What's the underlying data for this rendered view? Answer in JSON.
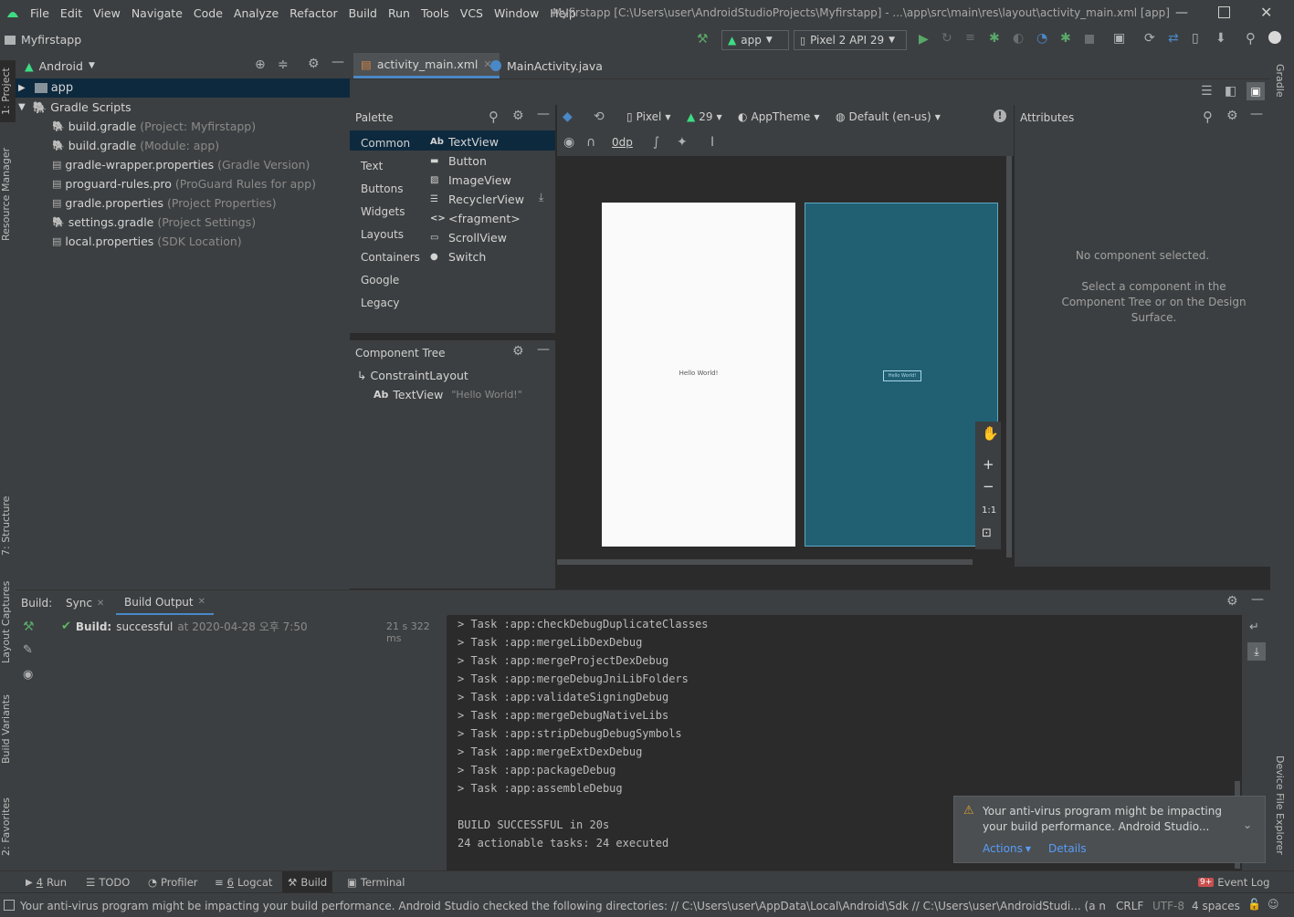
{
  "menu": [
    "File",
    "Edit",
    "View",
    "Navigate",
    "Code",
    "Analyze",
    "Refactor",
    "Build",
    "Run",
    "Tools",
    "VCS",
    "Window",
    "Help"
  ],
  "window_title": "Myfirstapp [C:\\Users\\user\\AndroidStudioProjects\\Myfirstapp] - ...\\app\\src\\main\\res\\layout\\activity_main.xml [app]",
  "toolbar": {
    "project": "Myfirstapp",
    "run_config": "app",
    "device": "Pixel 2 API 29"
  },
  "left_tabs": [
    "1: Project",
    "Resource Manager",
    "7: Structure",
    "Layout Captures",
    "Build Variants",
    "2: Favorites"
  ],
  "right_tabs": [
    "Gradle",
    "Device File Explorer"
  ],
  "project": {
    "view": "Android",
    "items": [
      {
        "label": "app",
        "hint": ""
      },
      {
        "label": "Gradle Scripts",
        "hint": ""
      },
      {
        "label": "build.gradle",
        "hint": "(Project: Myfirstapp)"
      },
      {
        "label": "build.gradle",
        "hint": "(Module: app)"
      },
      {
        "label": "gradle-wrapper.properties",
        "hint": "(Gradle Version)"
      },
      {
        "label": "proguard-rules.pro",
        "hint": "(ProGuard Rules for app)"
      },
      {
        "label": "gradle.properties",
        "hint": "(Project Properties)"
      },
      {
        "label": "settings.gradle",
        "hint": "(Project Settings)"
      },
      {
        "label": "local.properties",
        "hint": "(SDK Location)"
      }
    ]
  },
  "editor_tabs": [
    "activity_main.xml",
    "MainActivity.java"
  ],
  "palette": {
    "title": "Palette",
    "categories": [
      "Common",
      "Text",
      "Buttons",
      "Widgets",
      "Layouts",
      "Containers",
      "Google",
      "Legacy"
    ],
    "items": [
      "TextView",
      "Button",
      "ImageView",
      "RecyclerView",
      "<fragment>",
      "ScrollView",
      "Switch"
    ]
  },
  "design_toolbar": {
    "device": "Pixel",
    "api": "29",
    "theme": "AppTheme",
    "locale": "Default (en-us)",
    "margin": "0dp"
  },
  "component_tree": {
    "title": "Component Tree",
    "root": "ConstraintLayout",
    "child": "TextView",
    "child_text": "\"Hello World!\""
  },
  "preview_text": "Hello World!",
  "zoom_controls": [
    "+",
    "−",
    "1:1"
  ],
  "attributes": {
    "title": "Attributes",
    "empty": "No component selected.",
    "hint": "Select a component in the Component Tree or on the Design Surface."
  },
  "build": {
    "label": "Build:",
    "tabs": [
      "Sync",
      "Build Output"
    ],
    "result_label": "Build:",
    "result_status": "successful",
    "result_time": "at 2020-04-28 오후 7:50",
    "duration": "21 s 322 ms",
    "console": [
      "> Task :app:checkDebugDuplicateClasses",
      "> Task :app:mergeLibDexDebug",
      "> Task :app:mergeProjectDexDebug",
      "> Task :app:mergeDebugJniLibFolders",
      "> Task :app:validateSigningDebug",
      "> Task :app:mergeDebugNativeLibs",
      "> Task :app:stripDebugDebugSymbols",
      "> Task :app:mergeExtDexDebug",
      "> Task :app:packageDebug",
      "> Task :app:assembleDebug",
      "",
      "BUILD SUCCESSFUL in 20s",
      "24 actionable tasks: 24 executed"
    ]
  },
  "notification": {
    "text": "Your anti-virus program might be impacting your build performance. Android Studio...",
    "actions": "Actions",
    "details": "Details"
  },
  "bottom_tabs": [
    {
      "num": "4",
      "label": "Run"
    },
    {
      "num": "",
      "label": "TODO"
    },
    {
      "num": "",
      "label": "Profiler"
    },
    {
      "num": "6",
      "label": "Logcat"
    },
    {
      "num": "",
      "label": "Build"
    },
    {
      "num": "",
      "label": "Terminal"
    }
  ],
  "event_log": {
    "badge": "9+",
    "label": "Event Log"
  },
  "status": {
    "message": "Your anti-virus program might be impacting your build performance. Android Studio checked the following directories: // C:\\Users\\user\\AppData\\Local\\Android\\Sdk // C:\\Users\\user\\AndroidStudi... (a minute ago)",
    "line_sep": "CRLF",
    "encoding": "UTF-8",
    "indent": "4 spaces"
  },
  "colors": {
    "accent": "#4a88c7",
    "success": "#5fb85f",
    "blueprint": "#215f73",
    "run": "#59a869",
    "android": "#3ddc84"
  }
}
